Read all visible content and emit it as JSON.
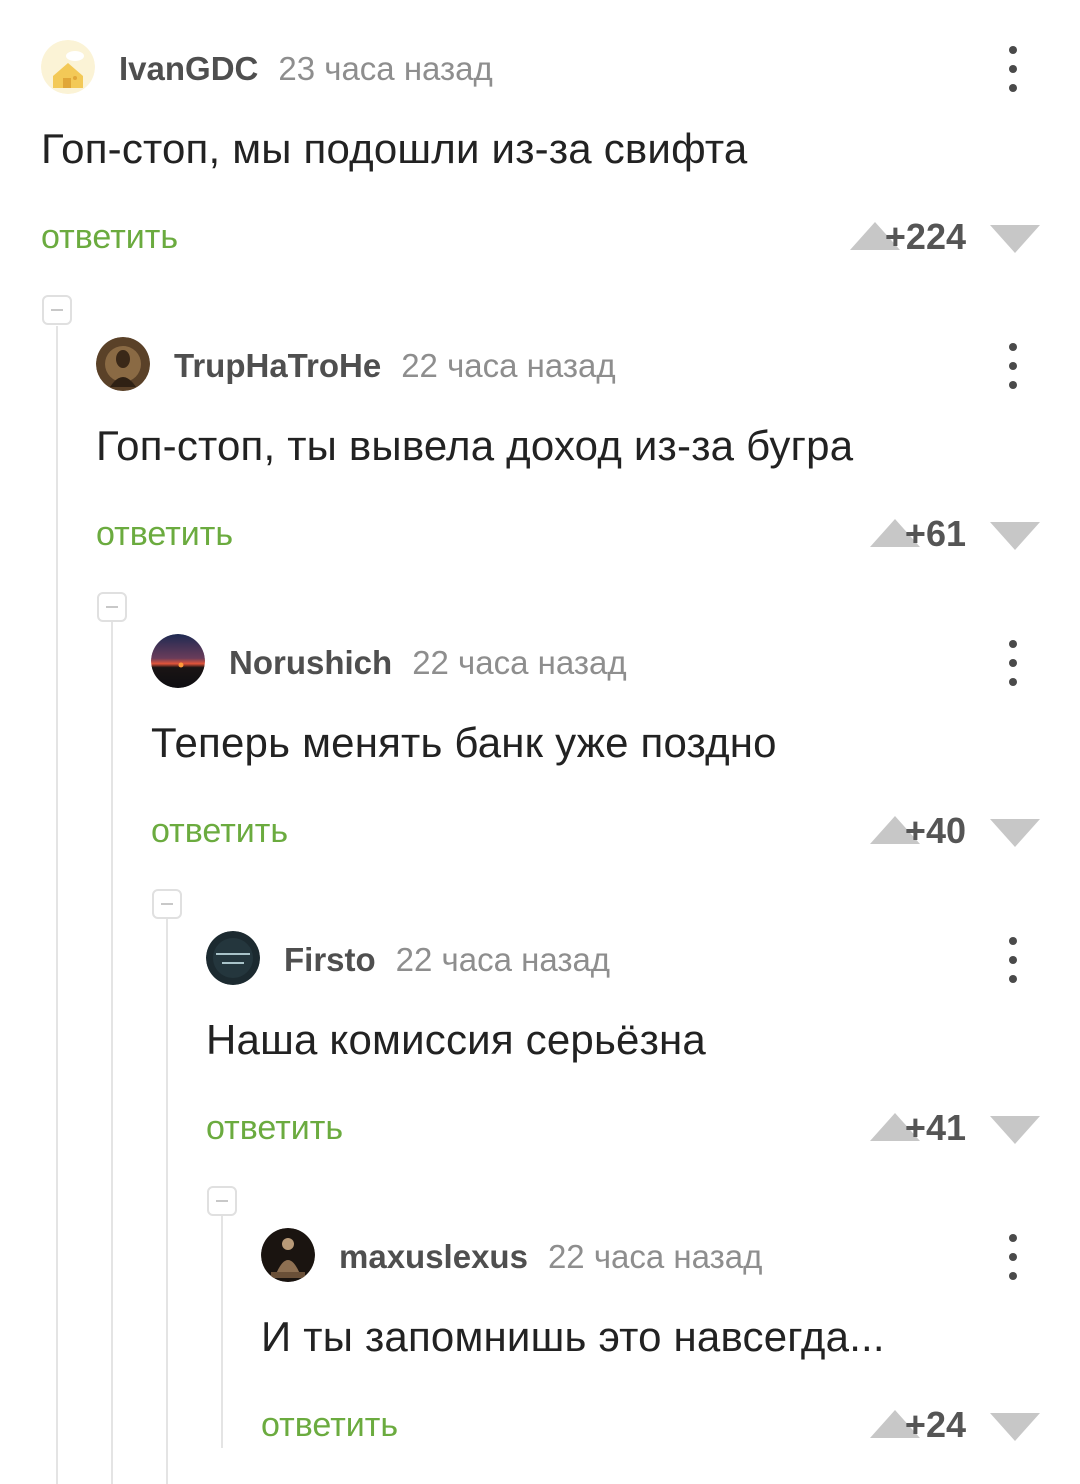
{
  "comments": [
    {
      "author": "IvanGDC",
      "time": "23 часа назад",
      "text": "Гоп-стоп, мы подошли из-за свифта",
      "reply_label": "ответить",
      "score": "+224",
      "avatar": "cartoon-house-avatar"
    },
    {
      "author": "TrupHaTroHe",
      "time": "22 часа назад",
      "text": "Гоп-стоп, ты вывела доход из-за бугра",
      "reply_label": "ответить",
      "score": "+61",
      "avatar": "dark-brown-figure-avatar"
    },
    {
      "author": "Norushich",
      "time": "22 часа назад",
      "text": "Теперь менять банк уже поздно",
      "reply_label": "ответить",
      "score": "+40",
      "avatar": "sunset-avatar"
    },
    {
      "author": "Firsto",
      "time": "22 часа назад",
      "text": "Наша комиссия серьёзна",
      "reply_label": "ответить",
      "score": "+41",
      "avatar": "dark-teal-text-avatar"
    },
    {
      "author": "maxuslexus",
      "time": "22 часа назад",
      "text": "И ты запомнишь это навсегда...",
      "reply_label": "ответить",
      "score": "+24",
      "avatar": "statue-avatar"
    }
  ],
  "colors": {
    "reply": "#6bab3f",
    "author": "#4f4f4f",
    "time": "#8e8e8e",
    "text": "#222222",
    "vote_arrow": "#c7c7c7",
    "thread_line": "#e4e4e4"
  }
}
